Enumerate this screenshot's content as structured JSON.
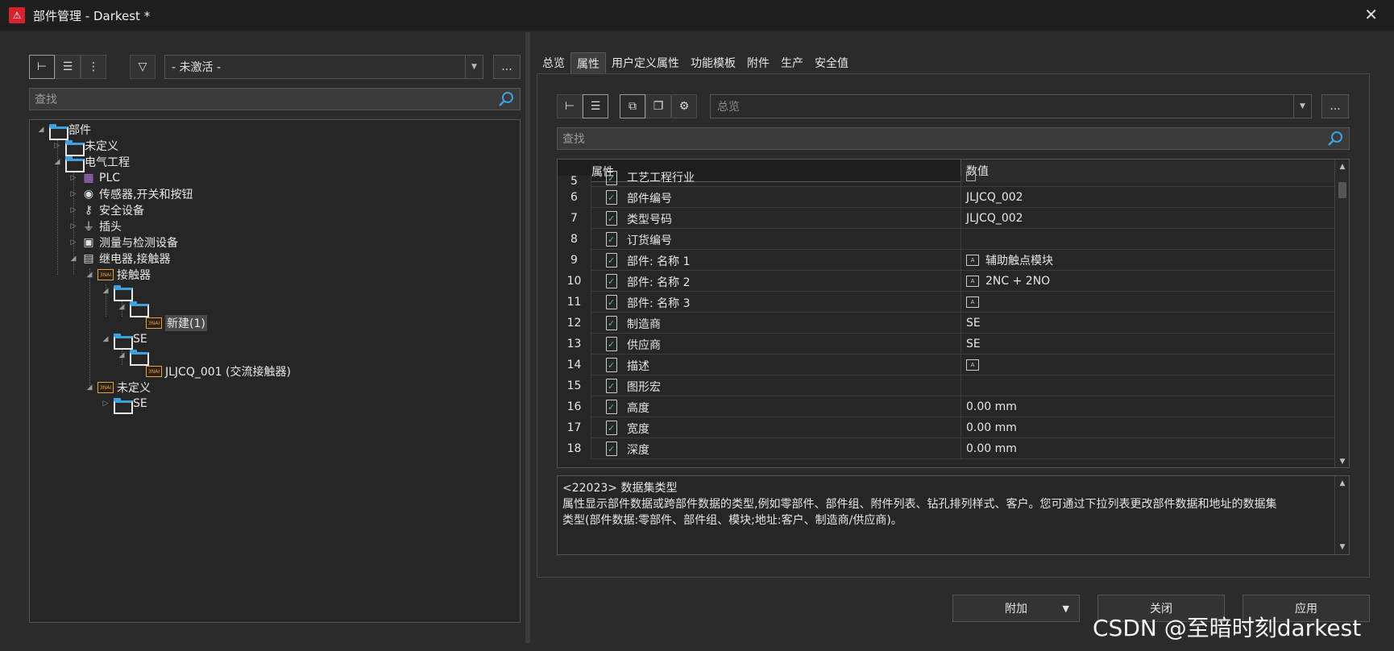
{
  "window": {
    "title": "部件管理 - Darkest *",
    "close_icon": "close-icon"
  },
  "left": {
    "filter_dropdown": "- 未激活 -",
    "dots": "...",
    "search_placeholder": "查找",
    "tree": {
      "root": "部件",
      "undefined1": "未定义",
      "electrical": "电气工程",
      "plc": "PLC",
      "sensors": "传感器,开关和按钮",
      "safety": "安全设备",
      "plugs": "插头",
      "measure": "测量与检测设备",
      "relays": "继电器,接触器",
      "contactor": "接触器",
      "new_item": "新建(1)",
      "se1": "SE",
      "jljcq001": "JLJCQ_001 (交流接触器)",
      "undefined2": "未定义",
      "se2": "SE"
    }
  },
  "right": {
    "tabs": [
      "总览",
      "属性",
      "用户定义属性",
      "功能模板",
      "附件",
      "生产",
      "安全值"
    ],
    "overview_dropdown": "总览",
    "dots": "...",
    "search_placeholder": "查找",
    "grid": {
      "col_prop": "属性",
      "col_val": "数值",
      "rows": [
        {
          "n": "5",
          "name": "工艺工程行业",
          "val": ""
        },
        {
          "n": "6",
          "name": "部件编号",
          "val": "JLJCQ_002"
        },
        {
          "n": "7",
          "name": "类型号码",
          "val": "JLJCQ_002"
        },
        {
          "n": "8",
          "name": "订货编号",
          "val": ""
        },
        {
          "n": "9",
          "name": "部件: 名称 1",
          "val": "辅助触点模块"
        },
        {
          "n": "10",
          "name": "部件: 名称 2",
          "val": "2NC + 2NO"
        },
        {
          "n": "11",
          "name": "部件: 名称 3",
          "val": ""
        },
        {
          "n": "12",
          "name": "制造商",
          "val": "SE"
        },
        {
          "n": "13",
          "name": "供应商",
          "val": "SE"
        },
        {
          "n": "14",
          "name": "描述",
          "val": ""
        },
        {
          "n": "15",
          "name": "图形宏",
          "val": ""
        },
        {
          "n": "16",
          "name": "高度",
          "val": "0.00 mm"
        },
        {
          "n": "17",
          "name": "宽度",
          "val": "0.00 mm"
        },
        {
          "n": "18",
          "name": "深度",
          "val": "0.00 mm"
        }
      ]
    },
    "description": {
      "line1": "<22023> 数据集类型",
      "line2": "属性显示部件数据或跨部件数据的类型,例如零部件、部件组、附件列表、钻孔排列样式、客户。您可通过下拉列表更改部件数据和地址的数据集",
      "line3": "类型(部件数据:零部件、部件组、模块;地址:客户、制造商/供应商)。"
    }
  },
  "buttons": {
    "attach": "附加",
    "close": "关闭",
    "apply": "应用"
  },
  "watermark": "CSDN @至暗时刻darkest"
}
